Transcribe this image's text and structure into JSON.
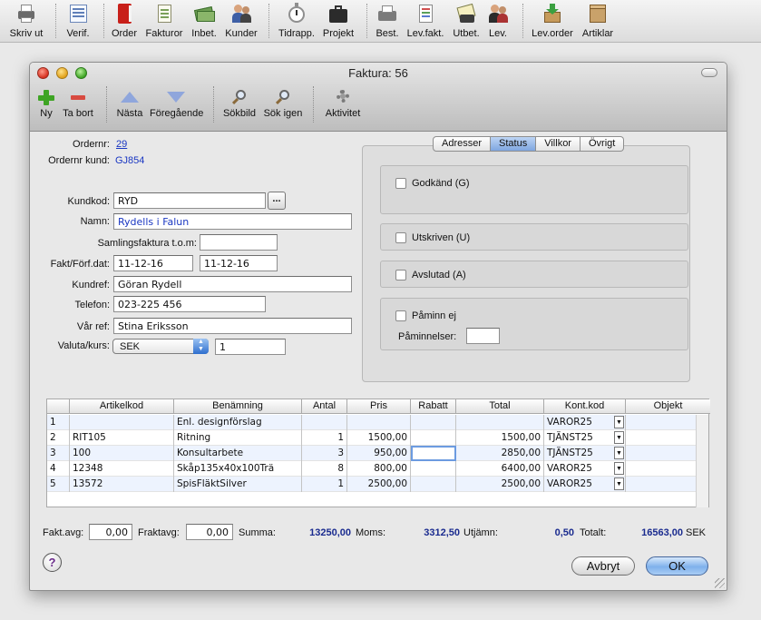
{
  "app_toolbar": {
    "items": [
      {
        "label": "Skriv ut",
        "icon": "printer-icon"
      },
      {
        "label": "Verif.",
        "icon": "ledger-icon"
      },
      {
        "label": "Order",
        "icon": "order-book-icon"
      },
      {
        "label": "Fakturor",
        "icon": "invoice-icon"
      },
      {
        "label": "Inbet.",
        "icon": "money-icon"
      },
      {
        "label": "Kunder",
        "icon": "customers-icon"
      },
      {
        "label": "Tidrapp.",
        "icon": "stopwatch-icon"
      },
      {
        "label": "Projekt",
        "icon": "briefcase-icon"
      },
      {
        "label": "Best.",
        "icon": "fax-icon"
      },
      {
        "label": "Lev.fakt.",
        "icon": "supplier-invoice-icon"
      },
      {
        "label": "Utbet.",
        "icon": "payment-icon"
      },
      {
        "label": "Lev.",
        "icon": "suppliers-icon"
      },
      {
        "label": "Lev.order",
        "icon": "supplier-order-icon"
      },
      {
        "label": "Artiklar",
        "icon": "box-icon"
      }
    ]
  },
  "window": {
    "title": "Faktura: 56",
    "toolbar": {
      "items": [
        {
          "label": "Ny",
          "icon": "plus-icon"
        },
        {
          "label": "Ta bort",
          "icon": "minus-icon"
        },
        {
          "label": "Nästa",
          "icon": "triangle-up-icon"
        },
        {
          "label": "Föregående",
          "icon": "triangle-down-icon"
        },
        {
          "label": "Sökbild",
          "icon": "magnifier-icon"
        },
        {
          "label": "Sök igen",
          "icon": "magnifier-again-icon"
        },
        {
          "label": "Aktivitet",
          "icon": "gear-icon"
        }
      ]
    }
  },
  "form": {
    "ordernr_label": "Ordernr:",
    "ordernr_value": "29",
    "ordernr_kund_label": "Ordernr kund:",
    "ordernr_kund_value": "GJ854",
    "kundkod_label": "Kundkod:",
    "kundkod_value": "RYD",
    "lookup_label": "...",
    "namn_label": "Namn:",
    "namn_value": "Rydells i Falun",
    "samlingsfaktura_label": "Samlingsfaktura t.o.m:",
    "samlingsfaktura_value": "",
    "fakt_dat_label": "Fakt/Förf.dat:",
    "fakt_dat_value": "11-12-16",
    "forf_dat_value": "11-12-16",
    "kundref_label": "Kundref:",
    "kundref_value": "Göran Rydell",
    "telefon_label": "Telefon:",
    "telefon_value": "023-225 456",
    "var_ref_label": "Vår ref:",
    "var_ref_value": "Stina Eriksson",
    "valuta_label": "Valuta/kurs:",
    "valuta_value": "SEK",
    "kurs_value": "1"
  },
  "status_panel": {
    "tabs": [
      "Adresser",
      "Status",
      "Villkor",
      "Övrigt"
    ],
    "active_tab": "Status",
    "godkand_label": "Godkänd (G)",
    "utskriven_label": "Utskriven (U)",
    "avslutad_label": "Avslutad (A)",
    "paminn_ej_label": "Påminn ej",
    "paminnelser_label": "Påminnelser:",
    "paminnelser_value": ""
  },
  "table": {
    "columns": [
      "",
      "Artikelkod",
      "Benämning",
      "Antal",
      "Pris",
      "Rabatt",
      "Total",
      "Kont.kod",
      "Objekt"
    ],
    "rows": [
      {
        "nr": "1",
        "artikelkod": "",
        "benamning": "Enl. designförslag",
        "antal": "",
        "pris": "",
        "rabatt": "",
        "total": "",
        "kontkod": "VAROR25",
        "objekt": ""
      },
      {
        "nr": "2",
        "artikelkod": "RIT105",
        "benamning": "Ritning",
        "antal": "1",
        "pris": "1500,00",
        "rabatt": "",
        "total": "1500,00",
        "kontkod": "TJÄNST25",
        "objekt": ""
      },
      {
        "nr": "3",
        "artikelkod": "100",
        "benamning": "Konsultarbete",
        "antal": "3",
        "pris": "950,00",
        "rabatt": "",
        "total": "2850,00",
        "kontkod": "TJÄNST25",
        "objekt": ""
      },
      {
        "nr": "4",
        "artikelkod": "12348",
        "benamning": "Skåp135x40x100Trä",
        "antal": "8",
        "pris": "800,00",
        "rabatt": "",
        "total": "6400,00",
        "kontkod": "VAROR25",
        "objekt": ""
      },
      {
        "nr": "5",
        "artikelkod": "13572",
        "benamning": "SpisFläktSilver",
        "antal": "1",
        "pris": "2500,00",
        "rabatt": "",
        "total": "2500,00",
        "kontkod": "VAROR25",
        "objekt": ""
      }
    ]
  },
  "summary": {
    "fakt_avg_label": "Fakt.avg:",
    "fakt_avg_value": "0,00",
    "fraktavg_label": "Fraktavg:",
    "fraktavg_value": "0,00",
    "summa_label": "Summa:",
    "summa_value": "13250,00",
    "moms_label": "Moms:",
    "moms_value": "3312,50",
    "utjamn_label": "Utjämn:",
    "utjamn_value": "0,50",
    "totalt_label": "Totalt:",
    "totalt_value": "16563,00",
    "currency": "SEK"
  },
  "buttons": {
    "help_label": "?",
    "avbryt_label": "Avbryt",
    "ok_label": "OK"
  },
  "colors": {
    "link_blue": "#1a37c2",
    "total_blue": "#1a2b8f",
    "default_button": "#7fb1ec"
  }
}
